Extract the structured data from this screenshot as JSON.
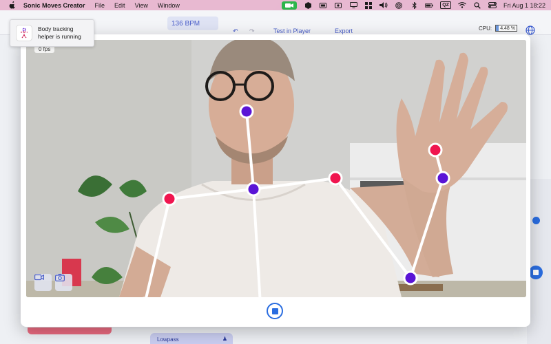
{
  "menubar": {
    "app_name": "Sonic Moves Creator",
    "menus": [
      "File",
      "Edit",
      "View",
      "Window"
    ],
    "datetime": "Fri Aug 1  18:22",
    "status_badge": "QZ"
  },
  "toolbar": {
    "bpm": "136 BPM",
    "test_label": "Test in Player",
    "export_label": "Export",
    "cpu_label": "CPU:",
    "cpu_value": "4.48 %"
  },
  "notification": {
    "text": "Body tracking helper is running"
  },
  "camera": {
    "fps": "0 fps",
    "skeleton_color": "#ffffff",
    "joint_color_primary": "#5a14d6",
    "joint_color_secondary": "#f0154f"
  },
  "controls": {
    "lowpass_label": "Lowpass",
    "stop_icon": "stop-icon",
    "video_icon": "video-camera-icon",
    "photo_icon": "camera-icon"
  },
  "colors": {
    "accent": "#2a6de0",
    "menubar_bg": "#e8bad2"
  }
}
